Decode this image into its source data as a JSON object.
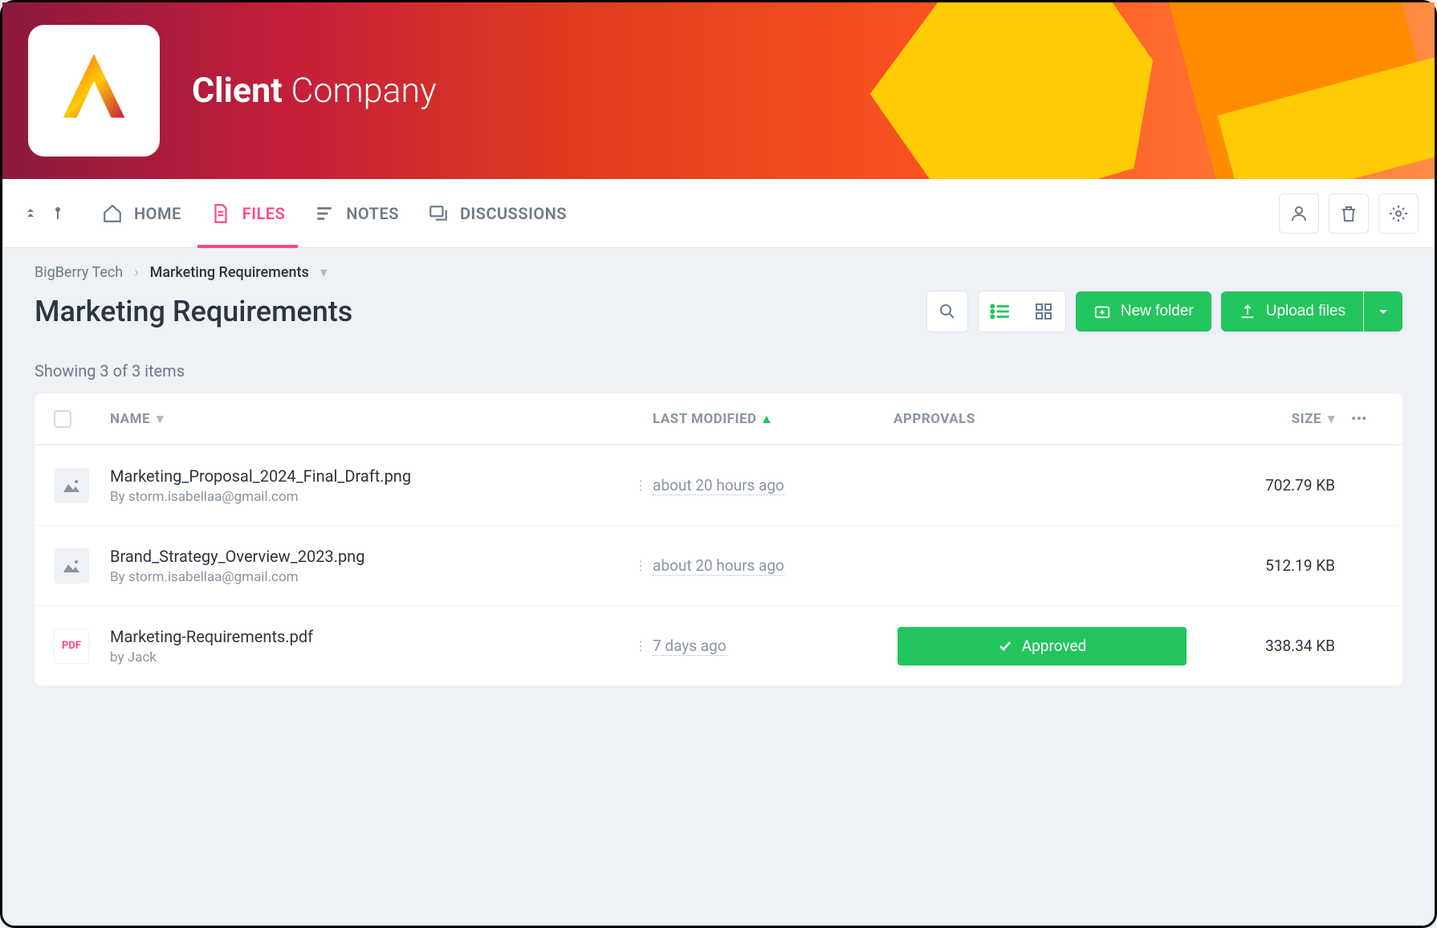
{
  "header": {
    "title_bold": "Client",
    "title_light": "Company"
  },
  "tabs": [
    {
      "label": "HOME",
      "icon": "home"
    },
    {
      "label": "FILES",
      "icon": "file"
    },
    {
      "label": "NOTES",
      "icon": "notes"
    },
    {
      "label": "DISCUSSIONS",
      "icon": "chat"
    }
  ],
  "breadcrumb": {
    "root": "BigBerry Tech",
    "current": "Marketing Requirements"
  },
  "page_title": "Marketing Requirements",
  "actions": {
    "new_folder": "New folder",
    "upload_files": "Upload files"
  },
  "count_label": "Showing 3 of 3 items",
  "columns": {
    "name": "NAME",
    "last_modified": "LAST MODIFIED",
    "approvals": "APPROVALS",
    "size": "SIZE"
  },
  "files": [
    {
      "name": "Marketing_Proposal_2024_Final_Draft.png",
      "author": "By storm.isabellaa@gmail.com",
      "modified": "about 20 hours ago",
      "approval": "",
      "size": "702.79 KB",
      "type": "img"
    },
    {
      "name": "Brand_Strategy_Overview_2023.png",
      "author": "By storm.isabellaa@gmail.com",
      "modified": "about 20 hours ago",
      "approval": "",
      "size": "512.19 KB",
      "type": "img"
    },
    {
      "name": "Marketing-Requirements.pdf",
      "author": "by Jack",
      "modified": "7 days ago",
      "approval": "Approved",
      "size": "338.34 KB",
      "type": "pdf"
    }
  ]
}
